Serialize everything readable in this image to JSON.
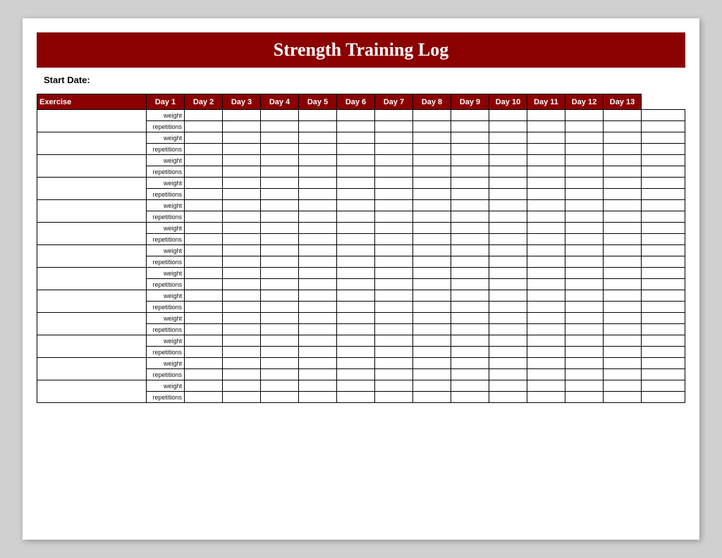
{
  "title": "Strength Training Log",
  "startDateLabel": "Start Date:",
  "columns": {
    "exercise": "Exercise",
    "days": [
      "Day 1",
      "Day 2",
      "Day 3",
      "Day 4",
      "Day 5",
      "Day 6",
      "Day 7",
      "Day 8",
      "Day 9",
      "Day 10",
      "Day 11",
      "Day 12",
      "Day 13"
    ]
  },
  "subRowLabels": [
    "weight",
    "repetitions"
  ],
  "numExercises": 13
}
